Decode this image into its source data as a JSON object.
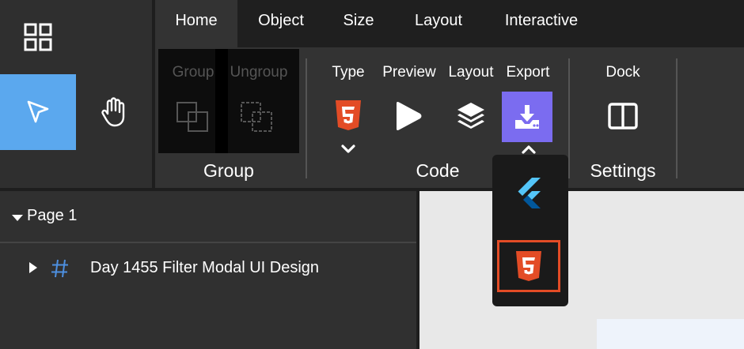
{
  "tabs": [
    "Home",
    "Object",
    "Size",
    "Layout",
    "Interactive"
  ],
  "ribbon": {
    "group": {
      "group_label": "Group",
      "ungroup_label": "Ungroup",
      "section": "Group"
    },
    "code": {
      "type_label": "Type",
      "preview_label": "Preview",
      "layout_label": "Layout",
      "export_label": "Export",
      "section": "Code"
    },
    "settings": {
      "dock_label": "Dock",
      "section": "Settings"
    }
  },
  "layers": {
    "page": "Page 1",
    "frame": "Day 1455 Filter Modal UI Design"
  },
  "export_dropdown": {
    "options": [
      "flutter-icon",
      "html5-icon"
    ]
  },
  "colors": {
    "accent": "#5ba8ee",
    "export": "#7b6cf0",
    "html5": "#e34c26",
    "flutter": "#54c5f8"
  }
}
